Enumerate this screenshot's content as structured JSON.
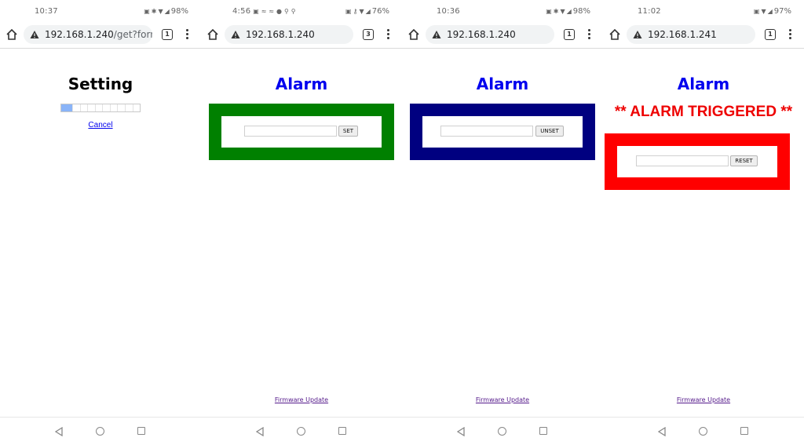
{
  "screens": [
    {
      "status": {
        "time": "10:37",
        "battery": "98%"
      },
      "url": {
        "host": "192.168.1.240",
        "path": "/get?formir"
      },
      "tab_count": "1",
      "heading": "Setting",
      "progress": 0.14,
      "cancel_label": "Cancel"
    },
    {
      "status": {
        "time": "4:56",
        "battery": "76%"
      },
      "url": {
        "host": "192.168.1.240",
        "path": ""
      },
      "tab_count": "3",
      "heading": "Alarm",
      "box_color": "#008000",
      "button_label": "SET",
      "footer_link": "Firmware Update"
    },
    {
      "status": {
        "time": "10:36",
        "battery": "98%"
      },
      "url": {
        "host": "192.168.1.240",
        "path": ""
      },
      "tab_count": "1",
      "heading": "Alarm",
      "box_color": "#000080",
      "button_label": "UNSET",
      "footer_link": "Firmware Update"
    },
    {
      "status": {
        "time": "11:02",
        "battery": "97%"
      },
      "url": {
        "host": "192.168.1.241",
        "path": ""
      },
      "tab_count": "1",
      "heading": "Alarm",
      "alert": "** ALARM TRIGGERED **",
      "box_color": "#ff0000",
      "button_label": "RESET",
      "footer_link": "Firmware Update"
    }
  ],
  "colors": {
    "link": "#0000ee",
    "alert": "#ee0000",
    "progress_fill": "#8ab4f8"
  },
  "icons": [
    "home-icon",
    "warning-icon",
    "tab-switcher-icon",
    "more-menu-icon",
    "nav-back-icon",
    "nav-home-icon",
    "nav-recents-icon"
  ]
}
